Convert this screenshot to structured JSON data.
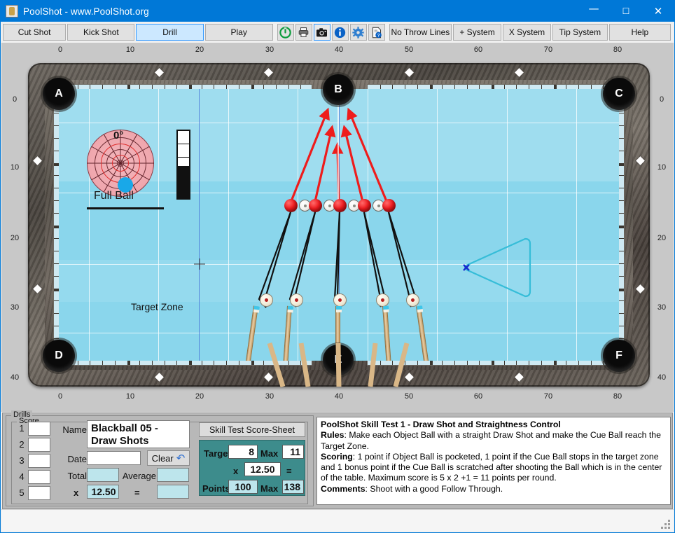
{
  "window": {
    "title": "PoolShot - www.PoolShot.org",
    "icon": "app-icon",
    "minimize": "—",
    "maximize": "☐",
    "close": "✕"
  },
  "toolbar": {
    "tabs": [
      {
        "label": "Cut Shot",
        "selected": false
      },
      {
        "label": "Kick Shot",
        "selected": false
      },
      {
        "label": "Drill",
        "selected": true
      },
      {
        "label": "Play",
        "selected": false
      }
    ],
    "icons": [
      {
        "name": "power-icon",
        "glyph": "⏻",
        "color": "#0c9c3c",
        "framed": false
      },
      {
        "name": "printer-icon",
        "glyph": "⎙",
        "color": "#3b3b3b",
        "framed": false
      },
      {
        "name": "camera-icon",
        "glyph": "◉",
        "color": "#1a1a1a",
        "framed": true
      },
      {
        "name": "info-icon",
        "glyph": "i",
        "color": "#0a62c6",
        "framed": false
      },
      {
        "name": "settings-icon",
        "glyph": "⚙",
        "color": "#2f7fd0",
        "framed": false
      },
      {
        "name": "help-doc-icon",
        "glyph": "὜E",
        "color": "#3b3b3b",
        "framed": false
      }
    ],
    "buttons": [
      {
        "label": "No Throw Lines"
      },
      {
        "label": "+ System"
      },
      {
        "label": "X System"
      },
      {
        "label": "Tip System"
      },
      {
        "label": "Help"
      }
    ]
  },
  "table": {
    "ruler_top": [
      "0",
      "10",
      "20",
      "30",
      "40",
      "50",
      "60",
      "70",
      "80"
    ],
    "ruler_bottom": [
      "0",
      "10",
      "20",
      "30",
      "40",
      "50",
      "60",
      "70",
      "80"
    ],
    "ruler_left": [
      "0",
      "10",
      "20",
      "30",
      "40"
    ],
    "ruler_right": [
      "0",
      "10",
      "20",
      "30",
      "40"
    ],
    "pockets": [
      {
        "label": "A",
        "kind": "corner",
        "pos": "top-left"
      },
      {
        "label": "B",
        "kind": "side",
        "pos": "top-center"
      },
      {
        "label": "C",
        "kind": "corner",
        "pos": "top-right"
      },
      {
        "label": "D",
        "kind": "corner",
        "pos": "bottom-left"
      },
      {
        "label": "E",
        "kind": "side",
        "pos": "bottom-center"
      },
      {
        "label": "F",
        "kind": "corner",
        "pos": "bottom-right"
      }
    ],
    "target_zone_label": "Target Zone",
    "spin": {
      "degrees": "0°",
      "contact_label": "Full Ball"
    },
    "cloth_color": "#8ad6ec",
    "arrow_color": "#ee1c1c",
    "zone_outline_color": "#36bdd8",
    "object_ball_color": "#ef1c20"
  },
  "bottom": {
    "drills_group": "Drills",
    "score_group": "Score",
    "rows": [
      "1",
      "2",
      "3",
      "4",
      "5"
    ],
    "name_label": "Name",
    "name_value": "Blackball 05 - Draw Shots",
    "date_label": "Date",
    "date_value": "",
    "clear_label": "Clear",
    "total_label": "Total",
    "total_value": "",
    "average_label": "Average",
    "average_value": "",
    "multiplier_symbol": "x",
    "multiplier_value": "12.50",
    "equals_symbol": "=",
    "result_value": "",
    "scoresheet_button": "Skill Test Score-Sheet",
    "target_label": "Target",
    "target_value": "8",
    "target_max_label": "Max",
    "target_max_value": "11",
    "teal_multiplier_symbol": "x",
    "teal_multiplier_value": "12.50",
    "teal_equals_symbol": "=",
    "points_label": "Points",
    "points_value": "100",
    "points_max_label": "Max",
    "points_max_value": "138"
  },
  "description": {
    "title": "PoolShot Skill Test 1 - Draw Shot and Straightness Control",
    "rules_label": "Rules",
    "rules_text": ": Make each Object Ball with a straight Draw Shot and make the Cue Ball reach the Target Zone.",
    "scoring_label": "Scoring",
    "scoring_text": ": 1 point if Object Ball is pocketed, 1 point if the Cue Ball stops in the target zone and 1 bonus point if the Cue Ball is scratched after shooting the Ball which is in the center of the table. Maximum score is 5 x 2 +1 = 11 points per round.",
    "comments_label": "Comments",
    "comments_text": ": Shoot with a good Follow Through."
  }
}
